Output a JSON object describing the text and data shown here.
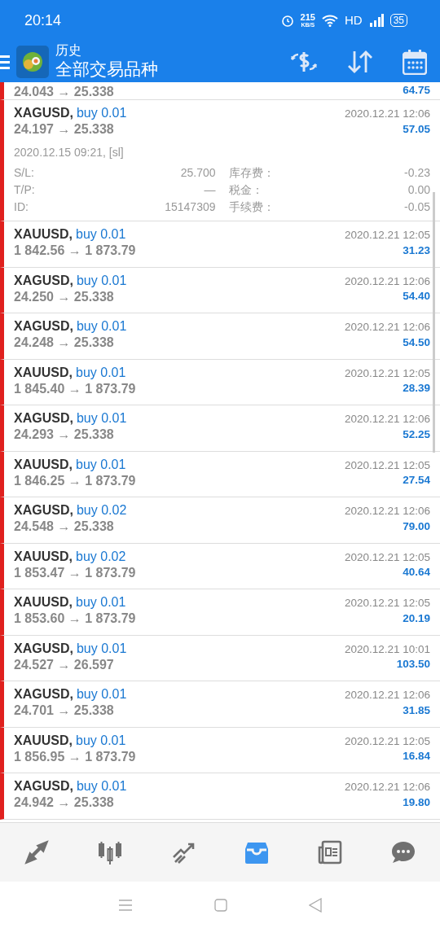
{
  "status_bar": {
    "time": "20:14",
    "net_speed": "215",
    "net_unit": "KB/S",
    "network": "HD",
    "battery": "35"
  },
  "app_bar": {
    "title": "历史",
    "subtitle": "全部交易品种"
  },
  "partial_row": {
    "prices": "24.043 → 25.338",
    "profit": "64.75"
  },
  "trades": [
    {
      "symbol": "XAGUSD,",
      "side": "buy 0.01",
      "prices": "24.197 → 25.338",
      "time": "2020.12.21 12:06",
      "profit": "57.05",
      "expanded": true,
      "open_info": "2020.12.15 09:21, [sl]",
      "details": [
        {
          "label": "S/L:",
          "value": "25.700",
          "label2": "库存费：",
          "value2": "-0.23"
        },
        {
          "label": "T/P:",
          "value": "—",
          "label2": "税金：",
          "value2": "0.00"
        },
        {
          "label": "ID:",
          "value": "15147309",
          "label2": "手续费：",
          "value2": "-0.05"
        }
      ]
    },
    {
      "symbol": "XAUUSD,",
      "side": "buy 0.01",
      "prices": "1 842.56 → 1 873.79",
      "time": "2020.12.21 12:05",
      "profit": "31.23",
      "expanded": false
    },
    {
      "symbol": "XAGUSD,",
      "side": "buy 0.01",
      "prices": "24.250 → 25.338",
      "time": "2020.12.21 12:06",
      "profit": "54.40",
      "expanded": false
    },
    {
      "symbol": "XAGUSD,",
      "side": "buy 0.01",
      "prices": "24.248 → 25.338",
      "time": "2020.12.21 12:06",
      "profit": "54.50",
      "expanded": false
    },
    {
      "symbol": "XAUUSD,",
      "side": "buy 0.01",
      "prices": "1 845.40 → 1 873.79",
      "time": "2020.12.21 12:05",
      "profit": "28.39",
      "expanded": false
    },
    {
      "symbol": "XAGUSD,",
      "side": "buy 0.01",
      "prices": "24.293 → 25.338",
      "time": "2020.12.21 12:06",
      "profit": "52.25",
      "expanded": false
    },
    {
      "symbol": "XAUUSD,",
      "side": "buy 0.01",
      "prices": "1 846.25 → 1 873.79",
      "time": "2020.12.21 12:05",
      "profit": "27.54",
      "expanded": false
    },
    {
      "symbol": "XAGUSD,",
      "side": "buy 0.02",
      "prices": "24.548 → 25.338",
      "time": "2020.12.21 12:06",
      "profit": "79.00",
      "expanded": false
    },
    {
      "symbol": "XAUUSD,",
      "side": "buy 0.02",
      "prices": "1 853.47 → 1 873.79",
      "time": "2020.12.21 12:05",
      "profit": "40.64",
      "expanded": false
    },
    {
      "symbol": "XAUUSD,",
      "side": "buy 0.01",
      "prices": "1 853.60 → 1 873.79",
      "time": "2020.12.21 12:05",
      "profit": "20.19",
      "expanded": false
    },
    {
      "symbol": "XAGUSD,",
      "side": "buy 0.01",
      "prices": "24.527 → 26.597",
      "time": "2020.12.21 10:01",
      "profit": "103.50",
      "expanded": false
    },
    {
      "symbol": "XAGUSD,",
      "side": "buy 0.01",
      "prices": "24.701 → 25.338",
      "time": "2020.12.21 12:06",
      "profit": "31.85",
      "expanded": false
    },
    {
      "symbol": "XAUUSD,",
      "side": "buy 0.01",
      "prices": "1 856.95 → 1 873.79",
      "time": "2020.12.21 12:05",
      "profit": "16.84",
      "expanded": false
    },
    {
      "symbol": "XAGUSD,",
      "side": "buy 0.01",
      "prices": "24.942 → 25.338",
      "time": "2020.12.21 12:06",
      "profit": "19.80",
      "expanded": false
    }
  ],
  "bottom_nav": [
    {
      "kind": "quotes",
      "selected": false
    },
    {
      "kind": "chart",
      "selected": false
    },
    {
      "kind": "trade",
      "selected": false
    },
    {
      "kind": "history",
      "selected": true
    },
    {
      "kind": "news",
      "selected": false
    },
    {
      "kind": "chat",
      "selected": false
    }
  ]
}
